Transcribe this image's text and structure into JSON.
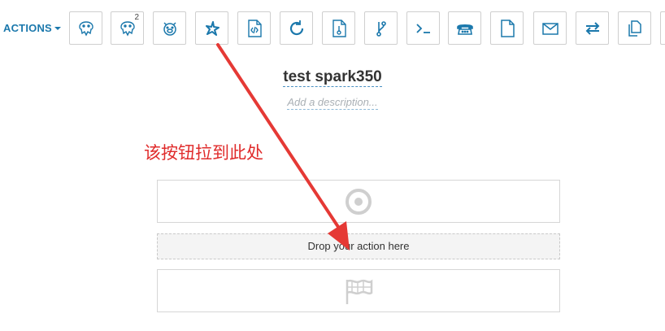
{
  "colors": {
    "accent": "#1b78ac",
    "icon_gray": "#cfcfcf",
    "annotation": "#e02b2b"
  },
  "toolbar": {
    "actions_label": "ACTIONS",
    "tools": [
      {
        "icon": "hive-icon"
      },
      {
        "icon": "hive2-icon",
        "badge": "2"
      },
      {
        "icon": "pig-icon"
      },
      {
        "icon": "spark-icon"
      },
      {
        "icon": "java-file-icon"
      },
      {
        "icon": "sync-icon"
      },
      {
        "icon": "script-file-icon"
      },
      {
        "icon": "git-branch-icon"
      },
      {
        "icon": "shell-icon"
      },
      {
        "icon": "ssh-phone-icon"
      },
      {
        "icon": "document-icon"
      },
      {
        "icon": "email-icon"
      },
      {
        "icon": "transfer-icon"
      },
      {
        "icon": "copy-icon"
      }
    ]
  },
  "workflow": {
    "title": "test spark350",
    "description_placeholder": "Add a description...",
    "drop_text": "Drop your action here",
    "start_icon": "target-icon",
    "end_icon": "finish-flag-icon"
  },
  "annotation": {
    "text": "该按钮拉到此处"
  }
}
